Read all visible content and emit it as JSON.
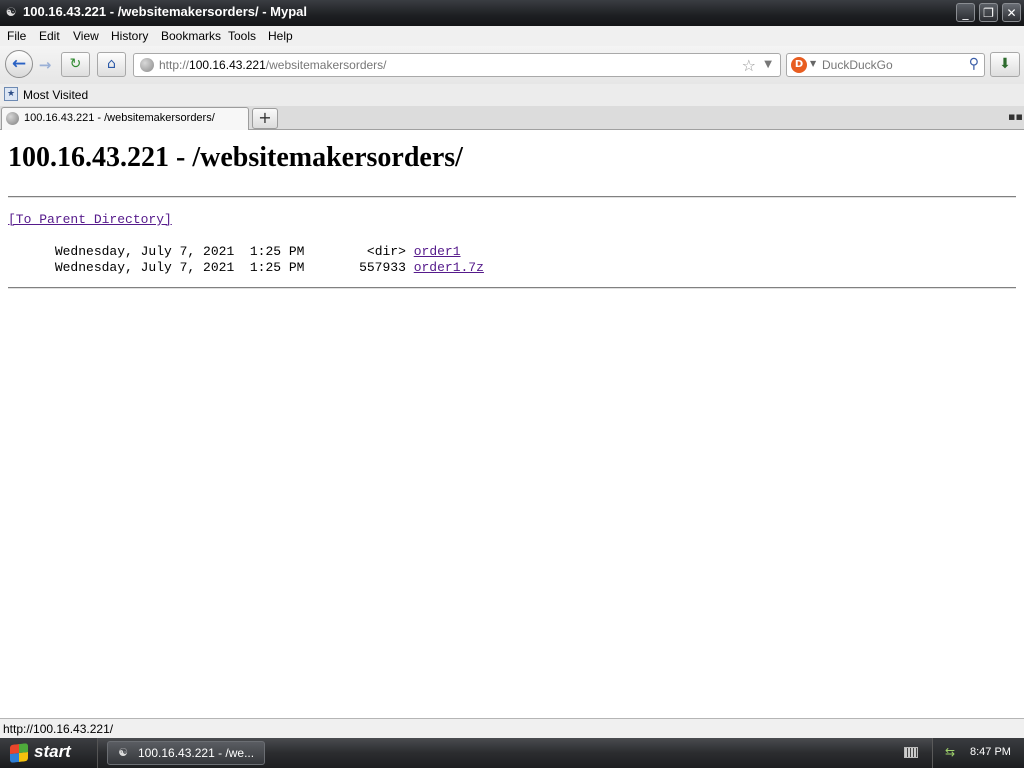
{
  "window": {
    "title": "100.16.43.221 - /websitemakersorders/ - Mypal",
    "buttons": {
      "minimize": "_",
      "restore": "❐",
      "close": "✕"
    }
  },
  "menu": {
    "items": [
      "File",
      "Edit",
      "View",
      "History",
      "Bookmarks",
      "Tools",
      "Help"
    ]
  },
  "nav": {
    "url_prefix": "http://",
    "url_host": "100.16.43.221",
    "url_path": "/websitemakersorders/",
    "search_placeholder": "DuckDuckGo",
    "search_engine_icon": "duckduckgo-icon"
  },
  "bookmarks": {
    "items": [
      "Most Visited"
    ]
  },
  "tabs": {
    "items": [
      {
        "label": "100.16.43.221 - /websitemakersorders/",
        "active": true
      }
    ],
    "new_tab": "+"
  },
  "page": {
    "heading": "100.16.43.221 - /websitemakersorders/",
    "parent_link": "[To Parent Directory]",
    "entries": [
      {
        "date": "Wednesday, July 7, 2021",
        "time": "1:25 PM",
        "size": "<dir>",
        "name": "order1"
      },
      {
        "date": "Wednesday, July 7, 2021",
        "time": "1:25 PM",
        "size": "557933",
        "name": "order1.7z"
      }
    ]
  },
  "status": {
    "text": "http://100.16.43.221/"
  },
  "taskbar": {
    "start_label": "start",
    "task_label": "100.16.43.221 - /we...",
    "clock": "8:47 PM"
  }
}
